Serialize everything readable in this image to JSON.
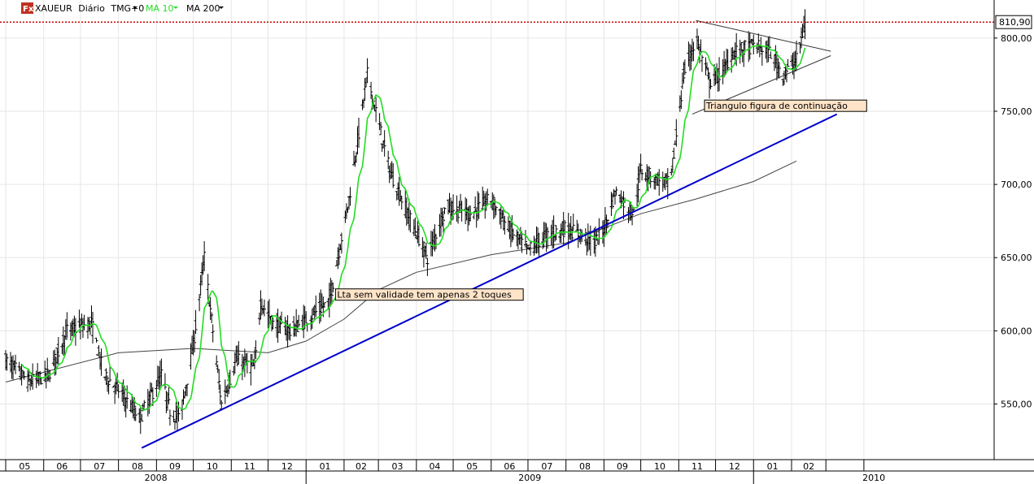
{
  "legend": {
    "symbol": "XAUEUR",
    "period": "Diário",
    "timezone": "TMG+0",
    "ma_fast_label": "MA 10",
    "ma_slow_label": "MA 200",
    "icon": "fx-icon"
  },
  "colors": {
    "bars": "#000000",
    "ma10": "#22dd22",
    "ma200": "#444444",
    "trendline": "#0000cc",
    "resistance": "#cc0000",
    "note_bg": "#ffe4c8",
    "triangle": "#333333"
  },
  "annotations": [
    {
      "id": "lta",
      "text": "Lta sem validade tem apenas 2 toques",
      "date": "2009-01-25",
      "price": 622
    },
    {
      "id": "triangle",
      "text": "Triangulo figura de continuação",
      "date": "2009-11-22",
      "price": 751
    }
  ],
  "price_label": "810,90",
  "chart_data": {
    "type": "candlestick",
    "title": "",
    "xlabel": "",
    "ylabel": "",
    "ylim": [
      512,
      826
    ],
    "yticks": [
      550,
      600,
      650,
      700,
      750,
      800
    ],
    "ytick_labels": [
      "550,00",
      "600,00",
      "650,00",
      "700,00",
      "750,00",
      "800,00"
    ],
    "grid": true,
    "xlim": [
      "2008-05-01",
      "2010-04-10"
    ],
    "months": [
      {
        "label": "05",
        "date": "2008-05-01"
      },
      {
        "label": "06",
        "date": "2008-06-01"
      },
      {
        "label": "07",
        "date": "2008-07-01"
      },
      {
        "label": "08",
        "date": "2008-08-01"
      },
      {
        "label": "09",
        "date": "2008-09-01"
      },
      {
        "label": "10",
        "date": "2008-10-01"
      },
      {
        "label": "11",
        "date": "2008-11-01"
      },
      {
        "label": "12",
        "date": "2008-12-01"
      },
      {
        "label": "01",
        "date": "2009-01-01"
      },
      {
        "label": "02",
        "date": "2009-02-01"
      },
      {
        "label": "03",
        "date": "2009-03-01"
      },
      {
        "label": "04",
        "date": "2009-04-01"
      },
      {
        "label": "05",
        "date": "2009-05-01"
      },
      {
        "label": "06",
        "date": "2009-06-01"
      },
      {
        "label": "07",
        "date": "2009-07-01"
      },
      {
        "label": "08",
        "date": "2009-08-01"
      },
      {
        "label": "09",
        "date": "2009-09-01"
      },
      {
        "label": "10",
        "date": "2009-10-01"
      },
      {
        "label": "11",
        "date": "2009-11-01"
      },
      {
        "label": "12",
        "date": "2009-12-01"
      },
      {
        "label": "01",
        "date": "2010-01-01"
      },
      {
        "label": "02",
        "date": "2010-02-01"
      },
      {
        "label": "",
        "date": "2010-03-01"
      },
      {
        "label": "",
        "date": "2010-04-01"
      }
    ],
    "years": [
      {
        "label": "2008",
        "date": "2008-05-01"
      },
      {
        "label": "2009",
        "date": "2009-01-01"
      },
      {
        "label": "2010",
        "date": "2010-01-01"
      }
    ],
    "series": [
      {
        "name": "XAUEUR",
        "key_dates": [
          "2008-05-01",
          "2008-05-20",
          "2008-06-05",
          "2008-06-20",
          "2008-07-10",
          "2008-07-20",
          "2008-08-01",
          "2008-08-18",
          "2008-09-05",
          "2008-09-12",
          "2008-09-20",
          "2008-10-01",
          "2008-10-10",
          "2008-10-24",
          "2008-11-05",
          "2008-11-20",
          "2008-11-25",
          "2008-12-05",
          "2008-12-20",
          "2009-01-05",
          "2009-01-20",
          "2009-02-05",
          "2009-02-20",
          "2009-03-10",
          "2009-03-25",
          "2009-04-10",
          "2009-04-25",
          "2009-05-15",
          "2009-06-01",
          "2009-06-15",
          "2009-07-01",
          "2009-07-15",
          "2009-08-01",
          "2009-08-15",
          "2009-08-25",
          "2009-09-01",
          "2009-09-10",
          "2009-09-25",
          "2009-10-01",
          "2009-10-10",
          "2009-10-25",
          "2009-11-05",
          "2009-11-15",
          "2009-11-26",
          "2009-12-05",
          "2009-12-15",
          "2010-01-01",
          "2010-01-15",
          "2010-01-25",
          "2010-02-05",
          "2010-02-12"
        ],
        "key_closes": [
          580,
          565,
          570,
          600,
          605,
          570,
          560,
          540,
          570,
          545,
          540,
          590,
          650,
          550,
          580,
          575,
          620,
          605,
          600,
          610,
          620,
          690,
          775,
          710,
          680,
          650,
          685,
          680,
          690,
          670,
          655,
          665,
          670,
          665,
          660,
          670,
          695,
          680,
          710,
          705,
          700,
          775,
          800,
          770,
          775,
          790,
          795,
          790,
          775,
          785,
          810
        ],
        "close": 810.9
      },
      {
        "name": "MA 10",
        "derived_from": "XAUEUR",
        "period": 10
      },
      {
        "name": "MA 200",
        "key_dates": [
          "2008-05-01",
          "2008-08-01",
          "2008-10-01",
          "2008-12-01",
          "2009-01-01",
          "2009-02-01",
          "2009-03-01",
          "2009-04-01",
          "2009-06-01",
          "2009-08-01",
          "2009-10-01",
          "2009-11-15",
          "2010-01-01",
          "2010-02-05"
        ],
        "key_values": [
          565,
          585,
          588,
          585,
          593,
          608,
          628,
          640,
          652,
          660,
          680,
          690,
          702,
          716
        ]
      }
    ],
    "lines": [
      {
        "name": "lta",
        "from": {
          "date": "2008-08-20",
          "price": 520
        },
        "to": {
          "date": "2010-03-10",
          "price": 748
        }
      },
      {
        "name": "triangle-upper",
        "from": {
          "date": "2009-11-15",
          "price": 812
        },
        "to": {
          "date": "2010-03-05",
          "price": 791
        }
      },
      {
        "name": "triangle-lower",
        "from": {
          "date": "2009-11-12",
          "price": 748
        },
        "to": {
          "date": "2010-03-05",
          "price": 788
        }
      },
      {
        "name": "resistance",
        "price": 810.9
      }
    ]
  }
}
